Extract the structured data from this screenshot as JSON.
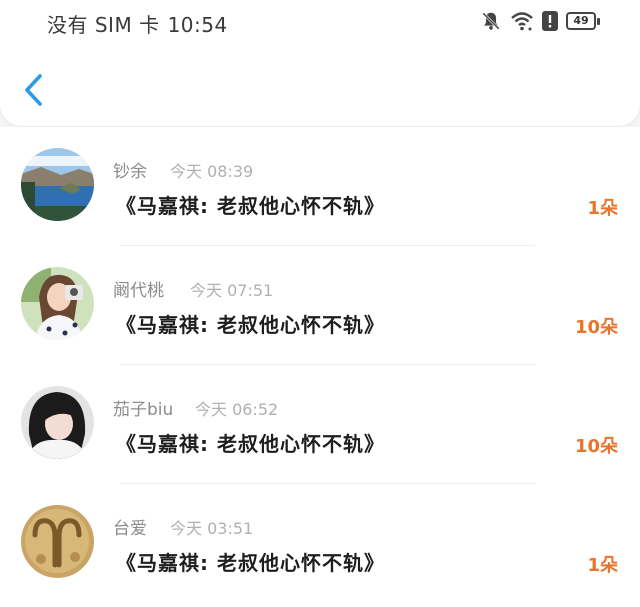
{
  "status_bar": {
    "carrier": "没有 SIM 卡",
    "time": "10:54",
    "battery": "49"
  },
  "feed": [
    {
      "name": "钞余",
      "timestamp": "今天 08:39",
      "title": "《马嘉祺:  老叔他心怀不轨》",
      "count": "1朵"
    },
    {
      "name": "阚代桃",
      "timestamp": "今天 07:51",
      "title": "《马嘉祺:  老叔他心怀不轨》",
      "count": "10朵"
    },
    {
      "name": "茄子biu",
      "timestamp": "今天 06:52",
      "title": "《马嘉祺:  老叔他心怀不轨》",
      "count": "10朵"
    },
    {
      "name": "台爱",
      "timestamp": "今天 03:51",
      "title": "《马嘉祺:  老叔他心怀不轨》",
      "count": "1朵"
    }
  ],
  "colors": {
    "accent_orange": "#e9742b",
    "back_blue": "#2b9be6"
  },
  "icons": [
    "back-arrow-icon",
    "bell-muted-icon",
    "wifi-icon",
    "alert-icon",
    "battery-icon"
  ]
}
